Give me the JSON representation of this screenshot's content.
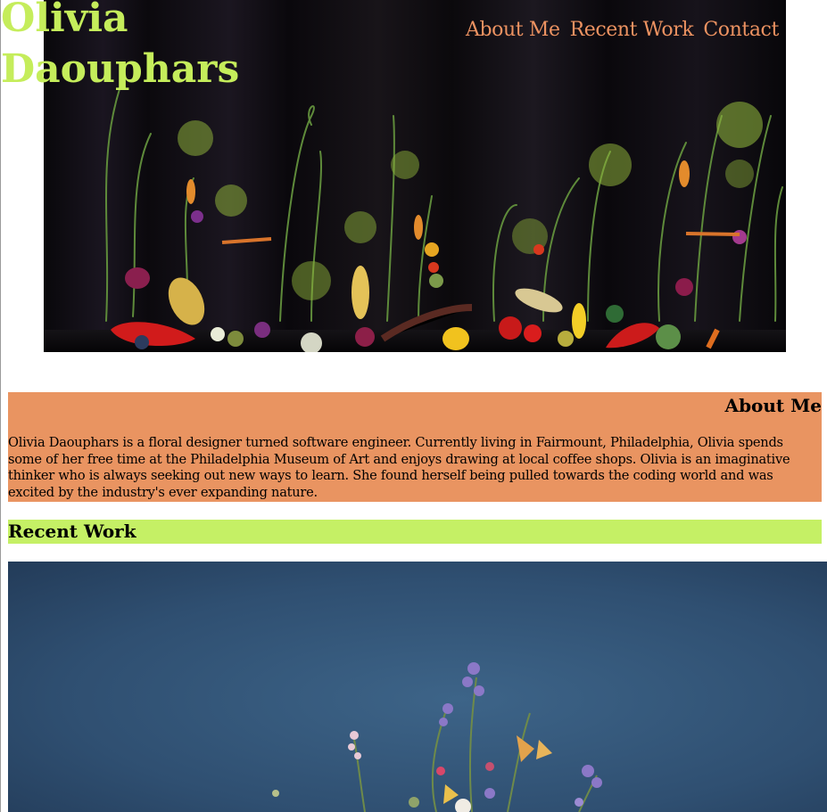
{
  "header": {
    "site_name": "Olivia Daouphars",
    "nav": [
      "About Me",
      "Recent Work",
      "Contact"
    ]
  },
  "hero_image": {
    "subject": "vegetable and flower still-life arrangement on black background"
  },
  "about": {
    "heading": "About Me",
    "body": "Olivia Daouphars is a floral designer turned software engineer. Currently living in Fairmount, Philadelphia, Olivia spends some of her free time at the Philadelphia Museum of Art and enjoys drawing at local coffee shops. Olivia is an imaginative thinker who is always seeking out new ways to learn. She found herself being pulled towards the coding world and was excited by the industry's ever expanding nature."
  },
  "recent_work": {
    "heading": "Recent Work",
    "image": {
      "subject": "floral arrangement on blue background"
    }
  },
  "colors": {
    "name": "#c5ed5b",
    "nav": "#ec9261",
    "about_band": "#e99461",
    "recent_band": "#c5f065",
    "hero_bg": "#120e14",
    "work_bg": "#2f4f71"
  }
}
